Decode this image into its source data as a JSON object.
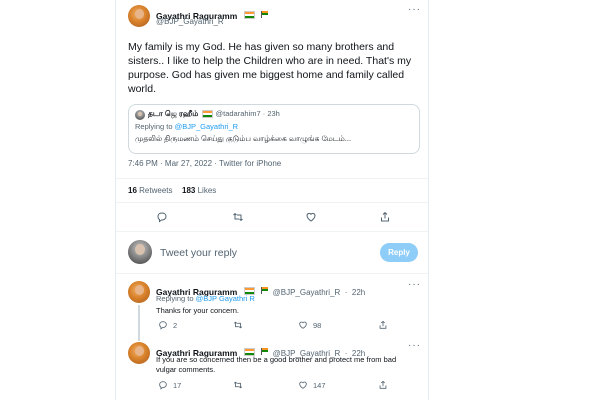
{
  "tweet": {
    "author_name": "Gayathri Raguramm",
    "author_handle": "@BJP_Gayathri_R",
    "text": "My family is my God. He has given so many brothers and sisters.. I like to help the Children who are in need. That's my purpose. God has given me biggest home and family called world.",
    "quote": {
      "author_name": "தடா ஜெ ரஹீம்",
      "author_handle": "@tadarahim7",
      "time": "23h",
      "replying_to_label": "Replying to",
      "replying_to_handle": "@BJP_Gayathri_R",
      "text": "முதலில் திருமணம் செய்து குடும்ப வாழ்க்கை வாழுங்க மேடம்..."
    },
    "timestamp": "7:46 PM · Mar 27, 2022 · Twitter for iPhone",
    "retweets_count": "16",
    "retweets_label": "Retweets",
    "likes_count": "183",
    "likes_label": "Likes"
  },
  "compose": {
    "placeholder": "Tweet your reply",
    "reply_button": "Reply"
  },
  "replies": [
    {
      "author_name": "Gayathri Raguramm",
      "author_handle": "@BJP_Gayathri_R",
      "time": "22h",
      "replying_to_label": "Replying to",
      "replying_to_handle": "@BJP Gayathri R",
      "text": "Thanks for your concern.",
      "reply_count": "2",
      "like_count": "98"
    },
    {
      "author_name": "Gayathri Raguramm",
      "author_handle": "@BJP_Gayathri_R",
      "time": "22h",
      "text": "If you are so concerned then be a good brother and protect me from bad vulgar comments.",
      "reply_count": "17",
      "like_count": "147"
    }
  ],
  "icons": {
    "reply": "reply-icon",
    "retweet": "retweet-icon",
    "like": "heart-icon",
    "share": "share-icon",
    "more": "more-icon"
  },
  "colors": {
    "accent": "#1d9bf0",
    "reply_button_disabled": "#8ecdf8",
    "secondary_text": "#536471"
  }
}
